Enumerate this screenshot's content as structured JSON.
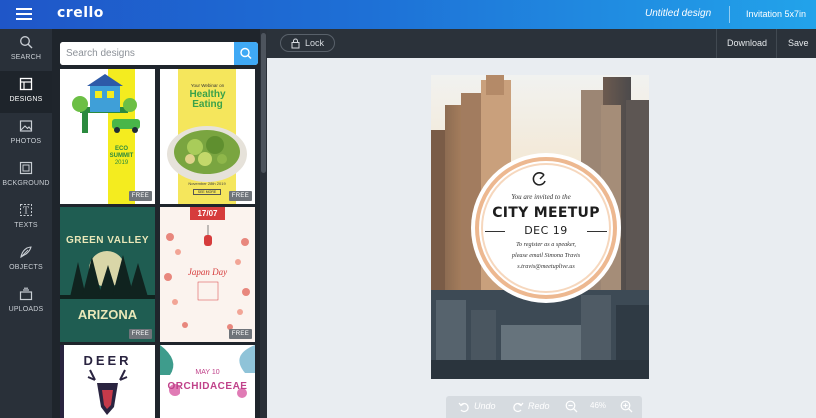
{
  "header": {
    "logo": "crello",
    "document_title": "Untitled design",
    "document_size": "Invitation 5x7in"
  },
  "rail": {
    "items": [
      {
        "label": "SEARCH",
        "icon": "search-icon"
      },
      {
        "label": "DESIGNS",
        "icon": "designs-icon",
        "active": true
      },
      {
        "label": "PHOTOS",
        "icon": "photo-icon"
      },
      {
        "label": "BCKGROUND",
        "icon": "background-icon"
      },
      {
        "label": "TEXTS",
        "icon": "text-icon"
      },
      {
        "label": "OBJECTS",
        "icon": "objects-icon"
      },
      {
        "label": "UPLOADS",
        "icon": "upload-icon"
      }
    ]
  },
  "designs_panel": {
    "search_placeholder": "Search designs",
    "free_badge": "FREE",
    "templates": [
      {
        "id": "eco",
        "lines": [
          "ECO",
          "SUMMIT",
          "2019"
        ],
        "free": true
      },
      {
        "id": "healthy",
        "lines": [
          "Your Webinar on",
          "Healthy",
          "Eating",
          "November 28th 2019",
          "SEE MORE"
        ],
        "free": true
      },
      {
        "id": "green-valley",
        "lines": [
          "GREEN VALLEY",
          "ARIZONA"
        ],
        "free": true
      },
      {
        "id": "japan-day",
        "lines": [
          "17/07",
          "Japan Day"
        ],
        "free": true
      },
      {
        "id": "deer",
        "lines": [
          "DEER"
        ],
        "free": false
      },
      {
        "id": "orchideae",
        "lines": [
          "MAY 10",
          "ORCHIDACEAE"
        ],
        "free": false
      }
    ]
  },
  "toolbar": {
    "lock_label": "Lock",
    "download_label": "Download",
    "save_label": "Save"
  },
  "canvas": {
    "invite_line": "You are invited to the",
    "title": "CITY MEETUP",
    "date": "DEC 19",
    "body_lines": [
      "To register as a speaker,",
      "please email Simona Travis",
      "s.travis@meetuplive.us"
    ]
  },
  "bottom_bar": {
    "undo_label": "Undo",
    "redo_label": "Redo",
    "zoom": "46%"
  },
  "colors": {
    "header_start": "#1f56c8",
    "header_end": "#22a3ea",
    "rail_bg": "#293039",
    "panel_bg": "#1f252c",
    "search_button": "#3fa9f5",
    "stage_bg": "#e9edf1"
  }
}
